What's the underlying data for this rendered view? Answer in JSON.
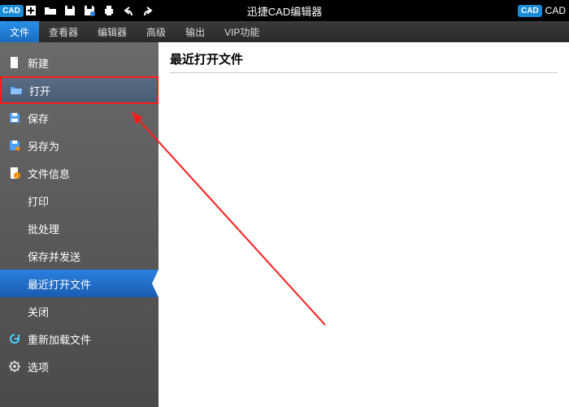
{
  "titlebar": {
    "title": "迅捷CAD编辑器",
    "right_label": "CAD"
  },
  "menubar": {
    "items": [
      {
        "label": "文件",
        "active": true
      },
      {
        "label": "查看器",
        "active": false
      },
      {
        "label": "编辑器",
        "active": false
      },
      {
        "label": "高级",
        "active": false
      },
      {
        "label": "输出",
        "active": false
      },
      {
        "label": "VIP功能",
        "active": false
      }
    ]
  },
  "sidebar": {
    "items": [
      {
        "label": "新建",
        "icon": "new-file"
      },
      {
        "label": "打开",
        "icon": "open-folder",
        "highlight": "red"
      },
      {
        "label": "保存",
        "icon": "save"
      },
      {
        "label": "另存为",
        "icon": "save-as"
      },
      {
        "label": "文件信息",
        "icon": "info"
      },
      {
        "label": "打印",
        "icon": ""
      },
      {
        "label": "批处理",
        "icon": ""
      },
      {
        "label": "保存并发送",
        "icon": ""
      },
      {
        "label": "最近打开文件",
        "icon": "",
        "selected": true
      },
      {
        "label": "关闭",
        "icon": ""
      },
      {
        "label": "重新加载文件",
        "icon": "reload"
      },
      {
        "label": "选项",
        "icon": "options"
      }
    ]
  },
  "content": {
    "heading": "最近打开文件"
  }
}
